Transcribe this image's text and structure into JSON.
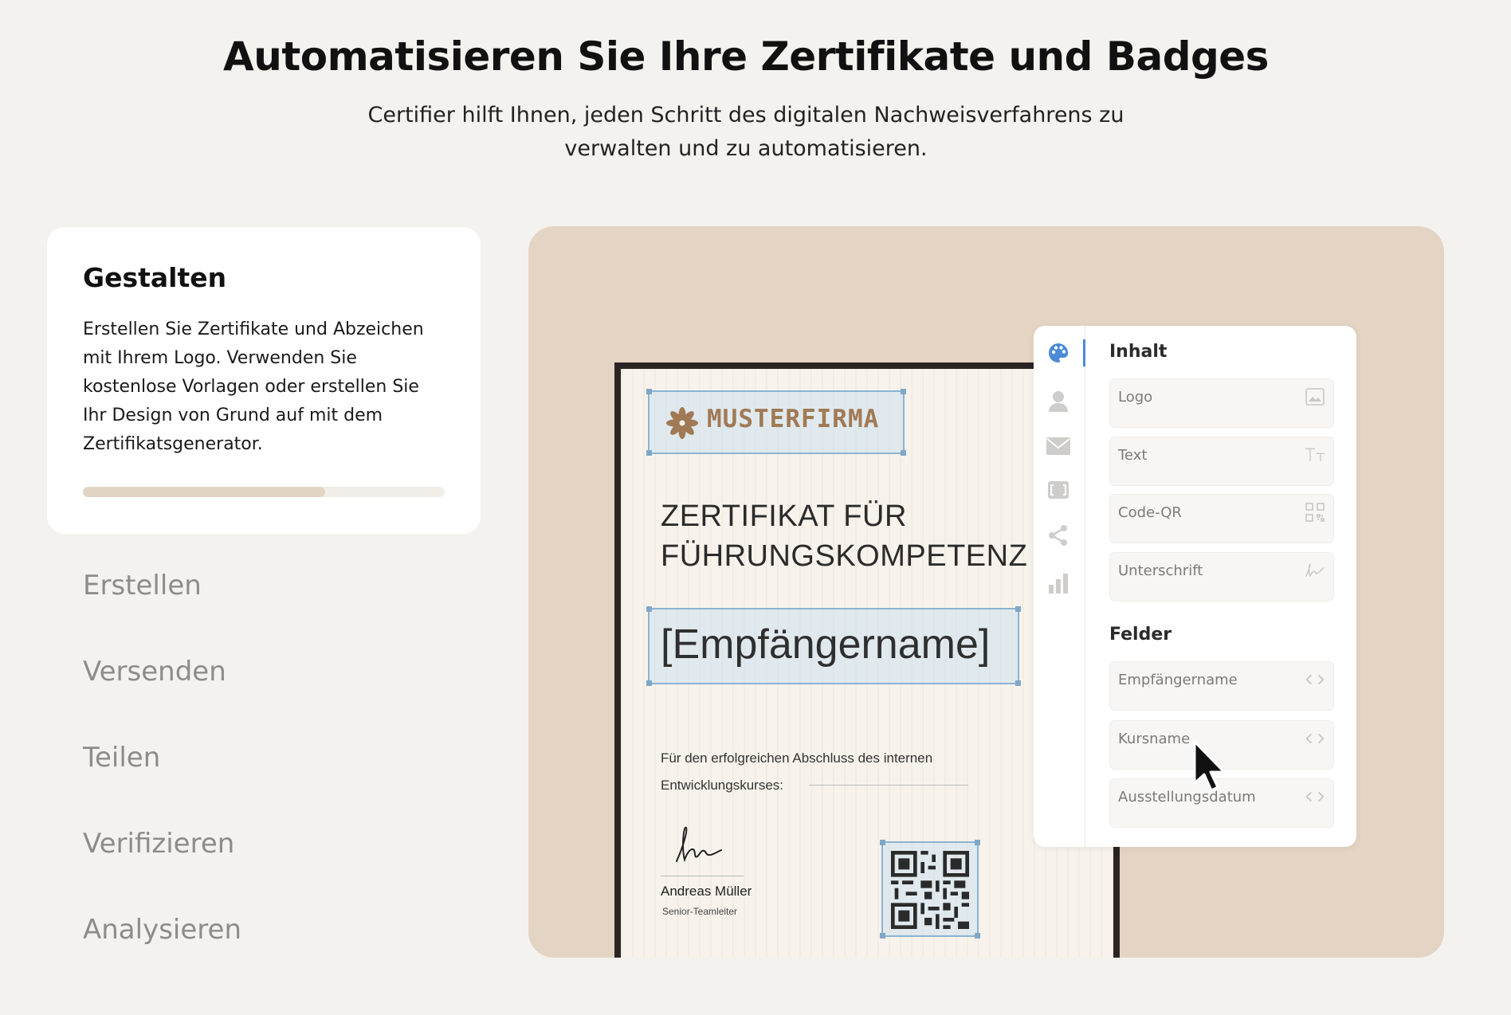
{
  "header": {
    "title": "Automatisieren Sie Ihre Zertifikate und Badges",
    "subtitle": "Certifier hilft Ihnen, jeden Schritt des digitalen Nachweisverfahrens zu verwalten und zu automatisieren."
  },
  "steps": {
    "active": {
      "title": "Gestalten",
      "description": "Erstellen Sie Zertifikate und Abzeichen mit Ihrem Logo. Verwenden Sie kostenlose Vorlagen oder erstellen Sie Ihr Design von Grund auf mit dem Zertifikatsgenerator.",
      "progress_percent": 67
    },
    "items": [
      {
        "label": "Erstellen"
      },
      {
        "label": "Versenden"
      },
      {
        "label": "Teilen"
      },
      {
        "label": "Verifizieren"
      },
      {
        "label": "Analysieren"
      }
    ]
  },
  "certificate": {
    "company": "MUSTERFIRMA",
    "title_line1": "ZERTIFIKAT FÜR",
    "title_line2": "FÜHRUNGSKOMPETENZ",
    "recipient_placeholder": "[Empfängername]",
    "body_line1": "Für den erfolgreichen Abschluss des internen",
    "body_line2": "Entwicklungskurses:",
    "signer_name": "Andreas Müller",
    "signer_role": "Senior-Teamleiter"
  },
  "editor": {
    "tools": [
      {
        "icon": "palette-icon"
      },
      {
        "icon": "user-icon"
      },
      {
        "icon": "mail-icon"
      },
      {
        "icon": "frame-icon"
      },
      {
        "icon": "share-icon"
      },
      {
        "icon": "bar-chart-icon"
      }
    ],
    "content_section": "Inhalt",
    "content_items": [
      {
        "label": "Logo",
        "icon": "image-icon"
      },
      {
        "label": "Text",
        "icon": "text-size-icon"
      },
      {
        "label": "Code-QR",
        "icon": "qr-icon"
      },
      {
        "label": "Unterschrift",
        "icon": "signature-icon"
      }
    ],
    "fields_section": "Felder",
    "field_items": [
      {
        "label": "Empfängername",
        "icon": "code-brackets-icon"
      },
      {
        "label": "Kursname",
        "icon": "code-brackets-icon"
      },
      {
        "label": "Ausstellungsdatum",
        "icon": "code-brackets-icon"
      }
    ]
  },
  "colors": {
    "page_bg": "#f4f2ef",
    "panel_bg": "#e4d4c3",
    "progress_fill": "#e2d4c3",
    "accent_blue": "#4a8ad6",
    "logo_brown": "#a07a55"
  }
}
